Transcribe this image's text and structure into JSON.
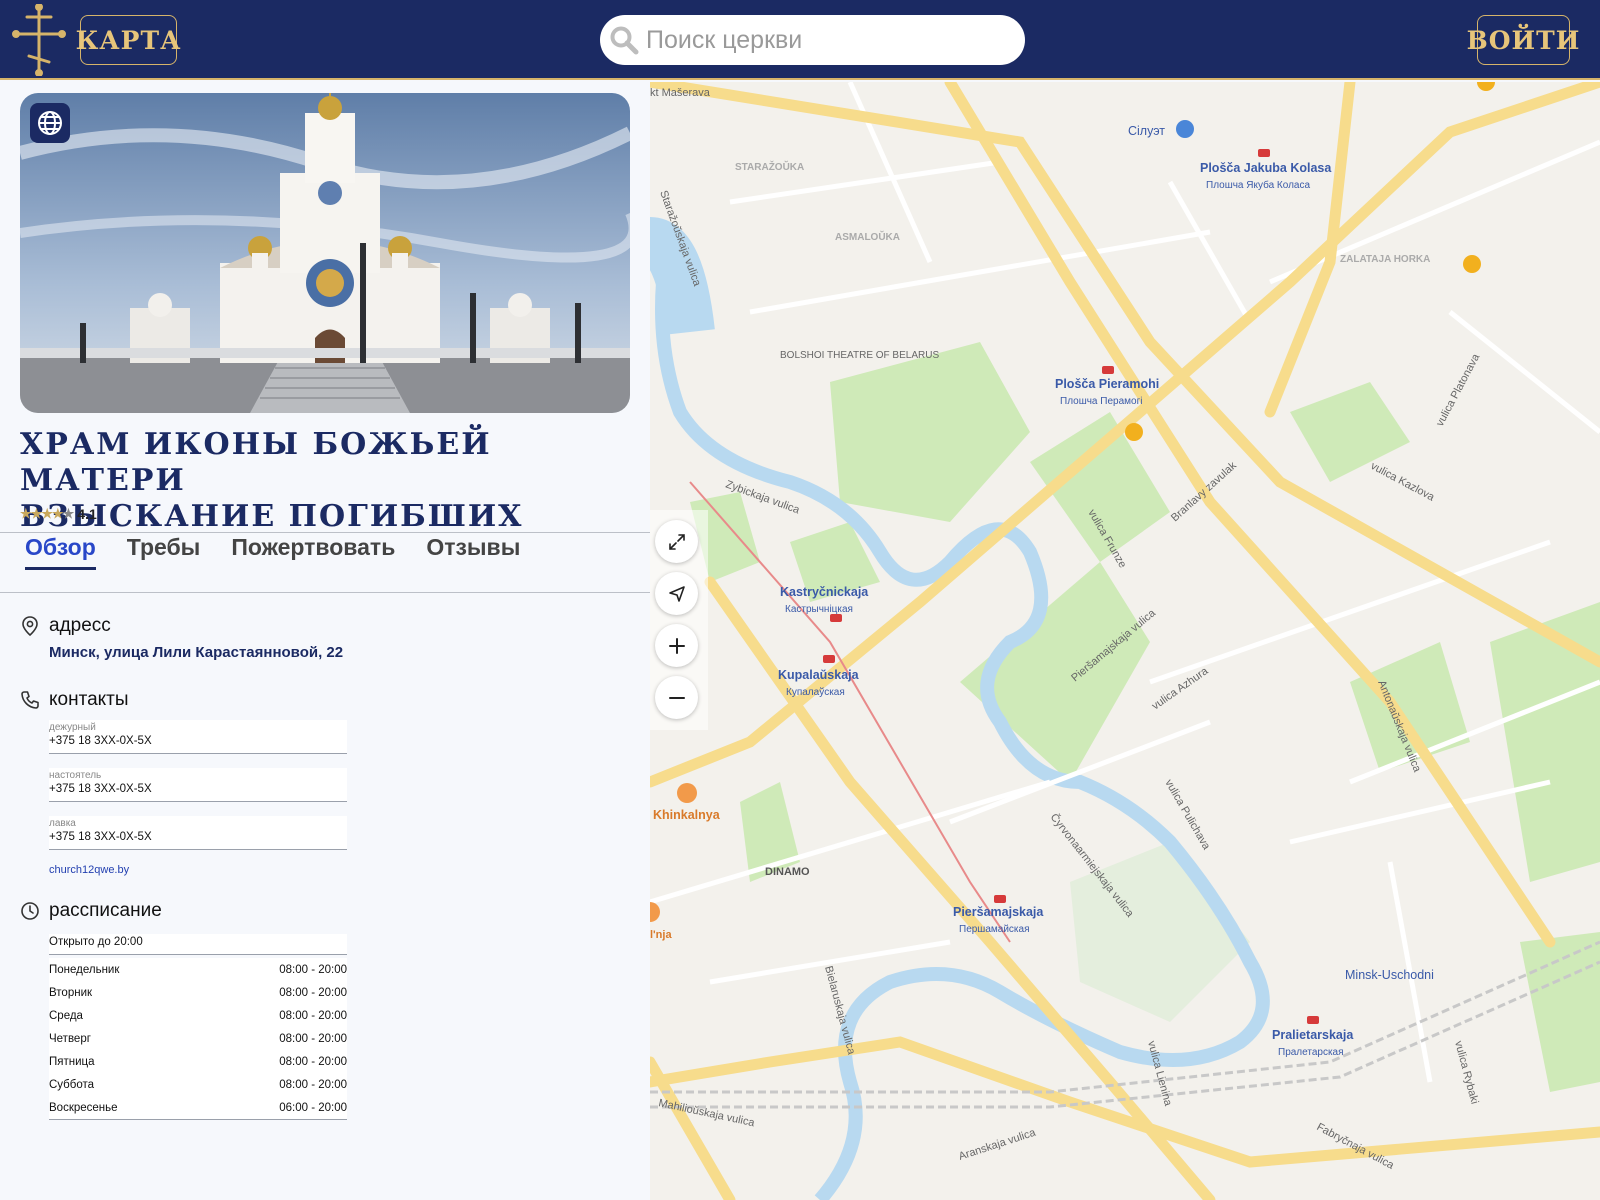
{
  "header": {
    "map_button": "КАРТА",
    "login_button": "ВОЙТИ",
    "search_placeholder": "Поиск церкви"
  },
  "church": {
    "title_line1": "ХРАМ ИКОНЫ БОЖЬЕЙ МАТЕРИ",
    "title_line2": "ВЗЫСКАНИЕ ПОГИБШИХ",
    "rating": "4.1",
    "rating_value": 4.1,
    "rating_max": 5
  },
  "tabs": [
    {
      "label": "Обзор",
      "active": true
    },
    {
      "label": "Требы",
      "active": false
    },
    {
      "label": "Пожертвовать",
      "active": false
    },
    {
      "label": "Отзывы",
      "active": false
    }
  ],
  "address": {
    "heading": "адресс",
    "value": "Минск, улица Лили Карастаянновой, 22"
  },
  "contacts": {
    "heading": "контакты",
    "items": [
      {
        "label": "дежурный",
        "phone": "+375 18 3XX-0X-5X"
      },
      {
        "label": "настоятель",
        "phone": "+375 18 3XX-0X-5X"
      },
      {
        "label": "лавка",
        "phone": "+375 18 3XX-0X-5X"
      }
    ],
    "website": "church12qwe.by"
  },
  "schedule": {
    "heading": "рассписание",
    "status": "Открыто до 20:00",
    "days": [
      {
        "day": "Понедельник",
        "hours": "08:00 - 20:00"
      },
      {
        "day": "Вторник",
        "hours": "08:00 - 20:00"
      },
      {
        "day": "Среда",
        "hours": "08:00 - 20:00"
      },
      {
        "day": "Четверг",
        "hours": "08:00 - 20:00"
      },
      {
        "day": "Пятница",
        "hours": "08:00 - 20:00"
      },
      {
        "day": "Суббота",
        "hours": "08:00 - 20:00"
      },
      {
        "day": "Воскресенье",
        "hours": "06:00 - 20:00"
      }
    ]
  },
  "map": {
    "labels": [
      "Kastryčnickaja",
      "Кастрычніцкая",
      "Kupalaŭskaja",
      "Купалаўская",
      "Plošča Pieramohi",
      "Плошча Перамогі",
      "Plošča Jakuba Kolasa",
      "Плошча Якуба Коласа",
      "Pieršamajskaja",
      "Першамайская",
      "Pralietarskaja",
      "Пралетарская",
      "Minsk-Uschodni",
      "Khinkalnya",
      "DINAMO",
      "BOLSHOI THEATRE OF BELARUS",
      "Сілуэт",
      "STARAŽOŬKA",
      "ASMALOŬKA",
      "ZALATAJA HORKA",
      "vulica Kazlova",
      "Zybickaja vulica",
      "vulica Frunze",
      "Pieršamajskaja vulica",
      "vulica Pulichava",
      "vulica Lienina",
      "Aranskaja vulica",
      "Mahilioŭskaja vulica",
      "Bielaruskaja vulica",
      "Čyrvonaarmiejskaja vulica",
      "Branlavy zavulak",
      "vulica Azhura",
      "Antonaŭskaja vulica",
      "vulica Platonava",
      "Fabryčnaja vulica",
      "vulica Rybaki",
      "Staražoŭskaja vulica",
      "kt Mašerava",
      "l'nja"
    ],
    "colors": {
      "background": "#f3f1ec",
      "major_road": "#f7dc8c",
      "minor_road": "#ffffff",
      "park": "#cfeab8",
      "river": "#b8d9f0",
      "metro": "#d63a3a",
      "label": "#3a5aa8"
    },
    "controls": [
      "fullscreen-icon",
      "locate-icon",
      "zoom-in-icon",
      "zoom-out-icon"
    ]
  }
}
